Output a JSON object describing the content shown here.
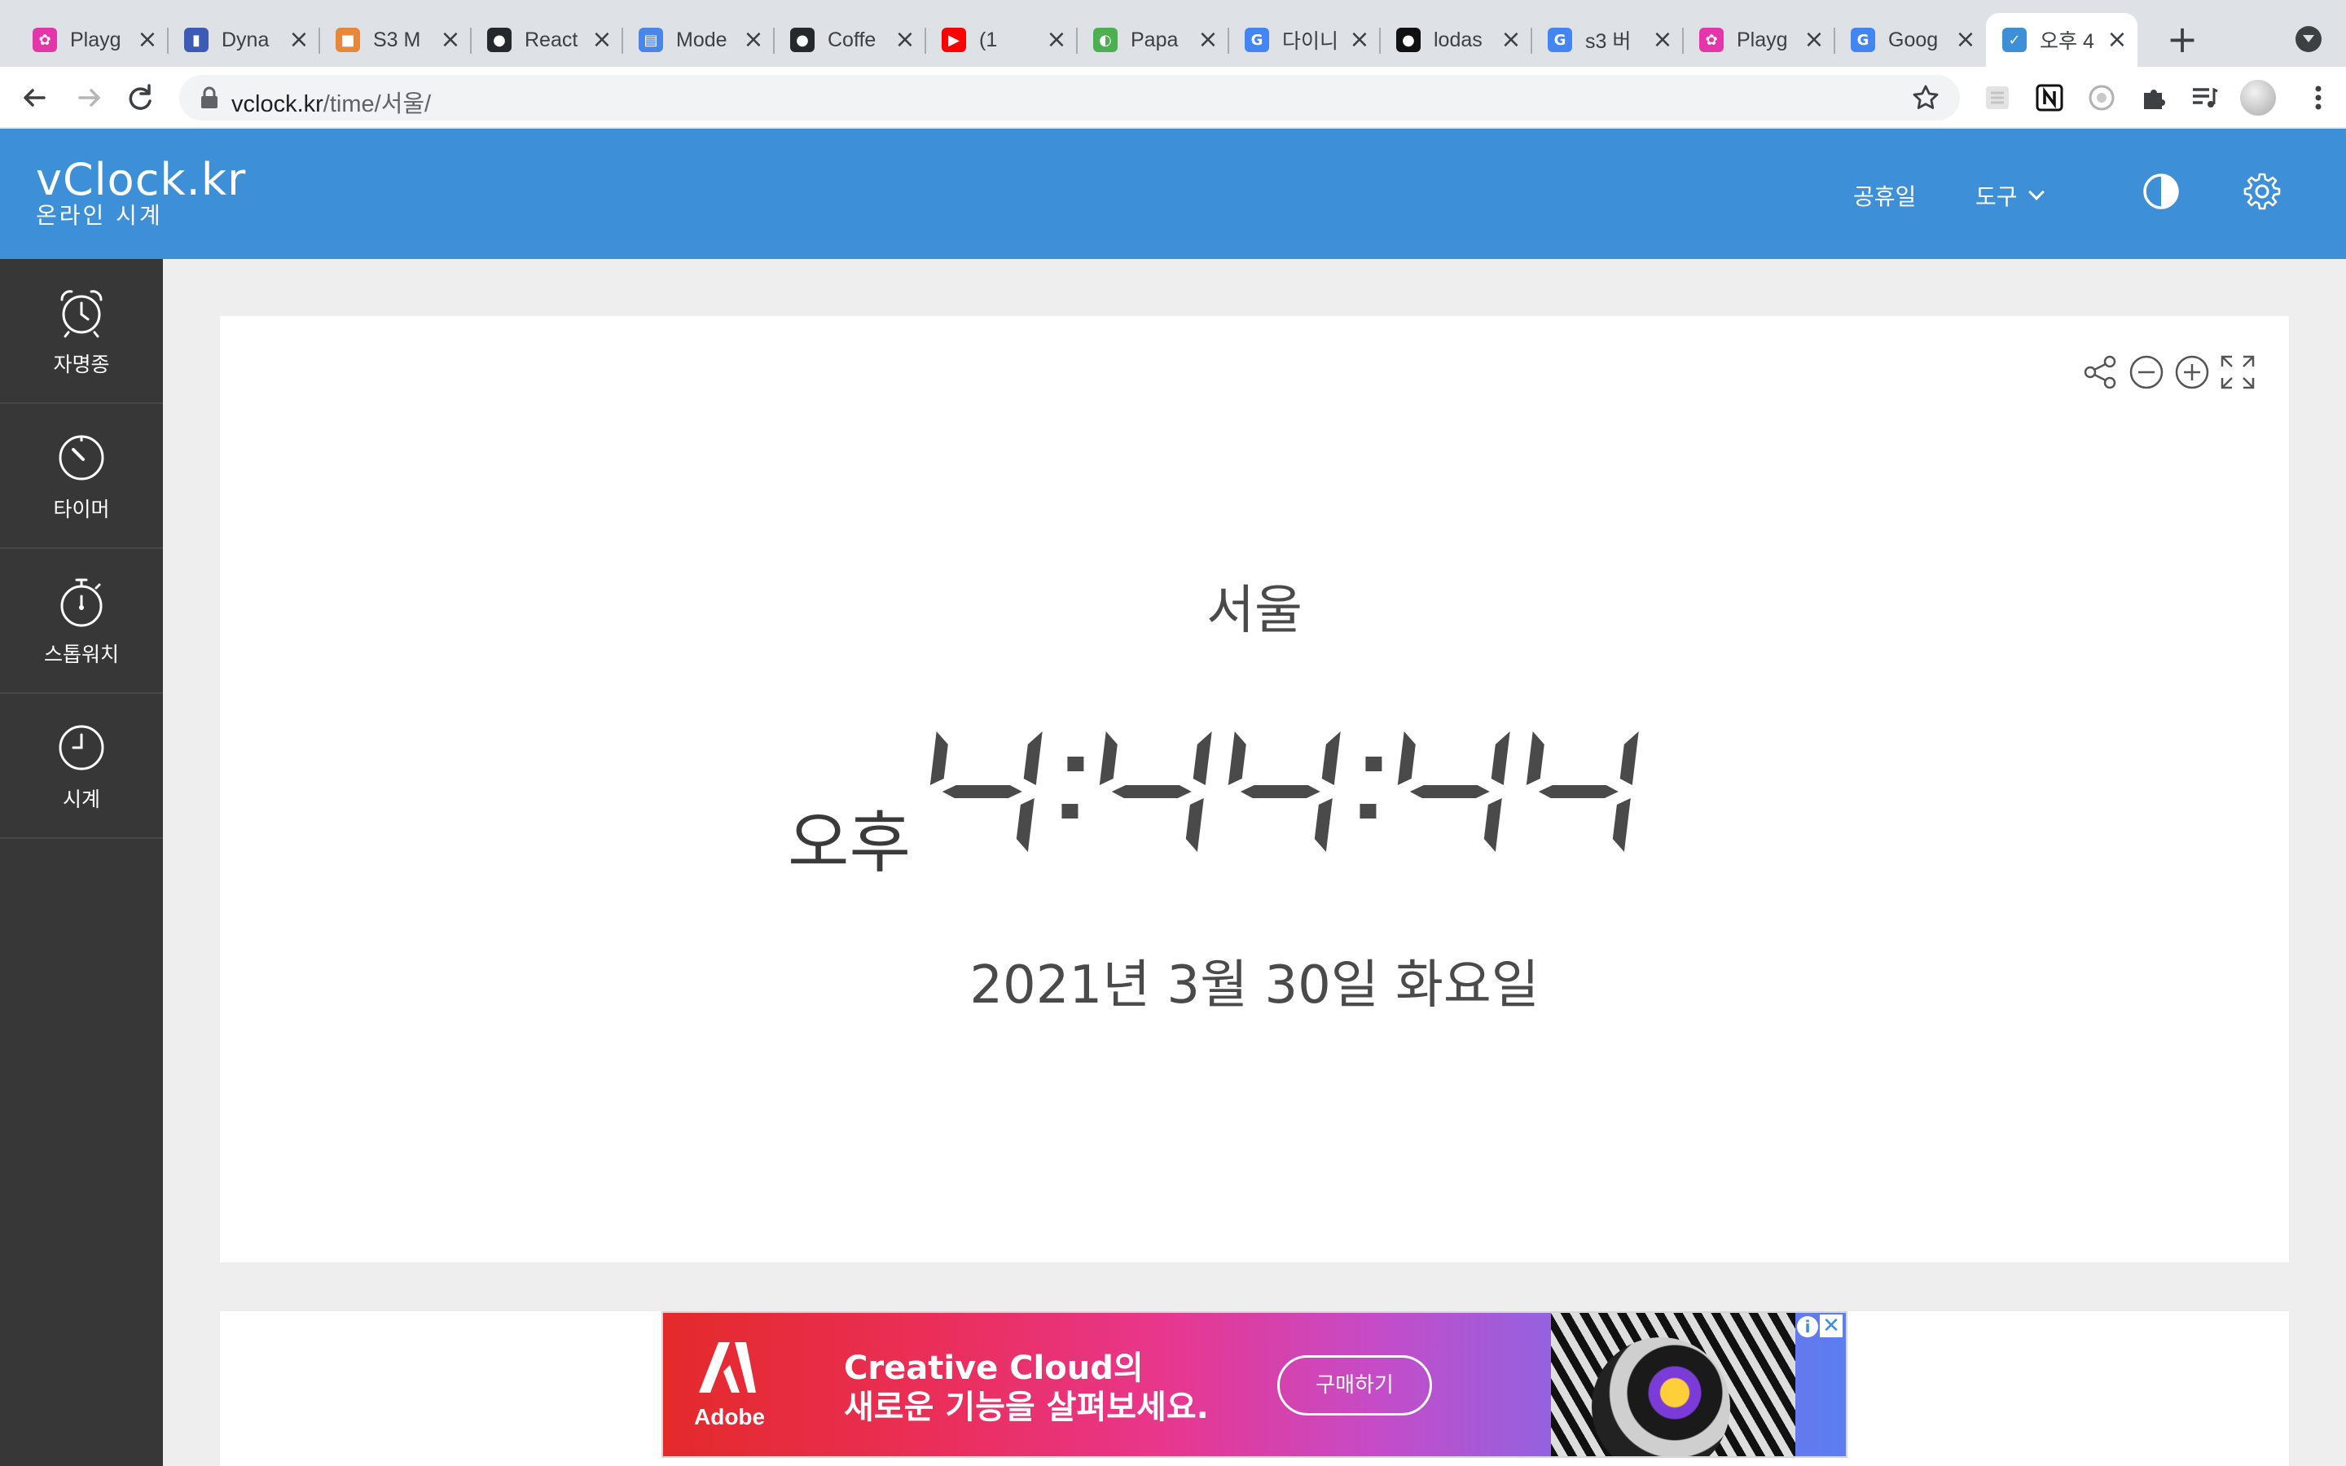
{
  "browser": {
    "tabs": [
      {
        "title": "Playg",
        "favicon_color": "#e535ab",
        "glyph": "✿"
      },
      {
        "title": "Dyna",
        "favicon_color": "#3b5bb5",
        "glyph": "▮"
      },
      {
        "title": "S3 M",
        "favicon_color": "#e8863a",
        "glyph": "■"
      },
      {
        "title": "React",
        "favicon_color": "#24292e",
        "glyph": "●"
      },
      {
        "title": "Mode",
        "favicon_color": "#4a86e8",
        "glyph": "▤"
      },
      {
        "title": "Coffe",
        "favicon_color": "#24292e",
        "glyph": "●"
      },
      {
        "title": "(1",
        "favicon_color": "#ff0000",
        "glyph": "▶"
      },
      {
        "title": "Papa",
        "favicon_color": "#4caf50",
        "glyph": "◐"
      },
      {
        "title": "다이니",
        "favicon_color": "#4285f4",
        "glyph": "G"
      },
      {
        "title": "lodas",
        "favicon_color": "#111111",
        "glyph": "●"
      },
      {
        "title": "s3 버",
        "favicon_color": "#4285f4",
        "glyph": "G"
      },
      {
        "title": "Playg",
        "favicon_color": "#e535ab",
        "glyph": "✿"
      },
      {
        "title": "Goog",
        "favicon_color": "#4285f4",
        "glyph": "G"
      },
      {
        "title": "오후 4",
        "favicon_color": "#3d8fd8",
        "glyph": "✓",
        "active": true
      }
    ],
    "url_host": "vclock.kr",
    "url_path": "/time/서울/"
  },
  "site": {
    "logo": "vClock.kr",
    "logo_sub": "온라인 시계",
    "nav_holidays": "공휴일",
    "nav_tools": "도구",
    "brand_color": "#3d8fd8"
  },
  "sidebar": {
    "items": [
      {
        "label": "자명종",
        "icon": "alarm-clock-icon"
      },
      {
        "label": "타이머",
        "icon": "timer-icon"
      },
      {
        "label": "스톱워치",
        "icon": "stopwatch-icon"
      },
      {
        "label": "시계",
        "icon": "clock-icon"
      }
    ]
  },
  "clock": {
    "city": "서울",
    "ampm": "오후",
    "time": "4:44:44",
    "date": "2021년 3월 30일 화요일"
  },
  "ad": {
    "brand": "Adobe",
    "headline_line1": "Creative Cloud의",
    "headline_line2": "새로운 기능을 살펴보세요.",
    "cta": "구매하기"
  }
}
